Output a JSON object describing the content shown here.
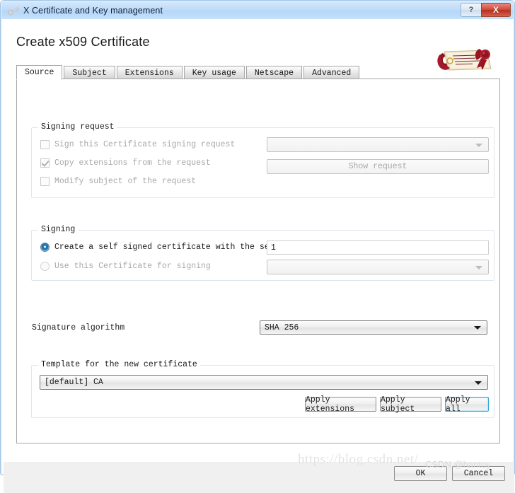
{
  "window": {
    "title": "X Certificate and Key management",
    "icon": "key-icon",
    "help_label": "?",
    "close_label": "X"
  },
  "page": {
    "heading": "Create x509 Certificate",
    "logo": "certificate-scroll-logo"
  },
  "tabs": [
    {
      "label": "Source",
      "active": true
    },
    {
      "label": "Subject",
      "active": false
    },
    {
      "label": "Extensions",
      "active": false
    },
    {
      "label": "Key usage",
      "active": false
    },
    {
      "label": "Netscape",
      "active": false
    },
    {
      "label": "Advanced",
      "active": false
    }
  ],
  "signing_request": {
    "group_title": "Signing request",
    "sign_csr": {
      "label": "Sign this Certificate signing request",
      "checked": false,
      "enabled": false
    },
    "copy_extensions": {
      "label": "Copy extensions from the request",
      "checked": true,
      "enabled": false
    },
    "modify_subject": {
      "label": "Modify subject of the request",
      "checked": false,
      "enabled": false
    },
    "request_combo": {
      "value": "",
      "enabled": false
    },
    "show_request_button": {
      "label": "Show request",
      "enabled": false
    }
  },
  "signing": {
    "group_title": "Signing",
    "self_signed": {
      "label": "Create a self signed certificate with the serial",
      "selected": true,
      "enabled": true
    },
    "serial_value": "1",
    "use_certificate": {
      "label": "Use this Certificate for signing",
      "selected": false,
      "enabled": false
    },
    "signer_combo": {
      "value": "",
      "enabled": false
    }
  },
  "signature": {
    "label": "Signature algorithm",
    "value": "SHA 256"
  },
  "template": {
    "group_title": "Template for the new certificate",
    "value": "[default] CA",
    "apply_extensions_label": "Apply extensions",
    "apply_subject_label": "Apply subject",
    "apply_all_label": "Apply all"
  },
  "footer": {
    "ok_label": "OK",
    "cancel_label": "Cancel",
    "watermark": "https://blog.csdn.net/",
    "watermark_author": "CSDN @hantoy"
  },
  "colors": {
    "titlebar": "#b6d7f8",
    "close": "#cf4a3a",
    "accent_focus": "#2fa8dd",
    "radio_on": "#1c79c0"
  }
}
